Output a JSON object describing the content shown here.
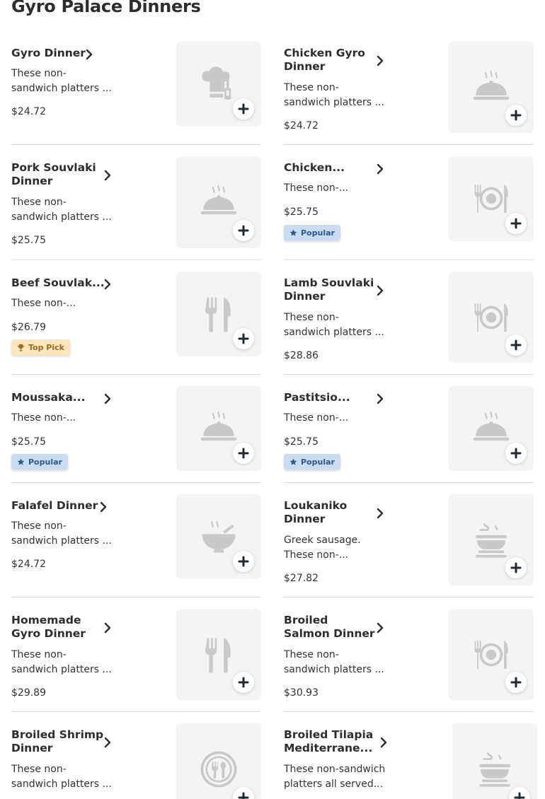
{
  "section": {
    "title": "Gyro Palace Dinners"
  },
  "badges": {
    "popular": "Popular",
    "top_pick": "Top Pick"
  },
  "colors": {
    "popular_bg": "#c9dcf2",
    "top_pick_bg": "#fde6bd",
    "thumb_bg": "#f4f4f4",
    "icon": "#c9c9c9"
  },
  "items": [
    {
      "name": "Gyro Dinner",
      "desc": "These non-\nsandwich platters ...",
      "price": "$24.72",
      "badge": "",
      "icon": "chef-icon"
    },
    {
      "name": "Chicken Gyro\nDinner",
      "desc": "These non-\nsandwich platters ...",
      "price": "$24.72",
      "badge": "",
      "icon": "cloche-icon"
    },
    {
      "name": "Pork Souvlaki\nDinner",
      "desc": "These non-\nsandwich platters ...",
      "price": "$25.75",
      "badge": "",
      "icon": "cloche-icon"
    },
    {
      "name": "Chicken...",
      "desc": "These non-...",
      "price": "$25.75",
      "badge": "Popular",
      "icon": "plate-cutlery-icon"
    },
    {
      "name": "Beef Souvlak...",
      "desc": "These non-...",
      "price": "$26.79",
      "badge": "Top Pick",
      "icon": "fork-knife-icon"
    },
    {
      "name": "Lamb Souvlaki\nDinner",
      "desc": "These non-\nsandwich platters ...",
      "price": "$28.86",
      "badge": "",
      "icon": "plate-cutlery-icon"
    },
    {
      "name": "Moussaka...",
      "desc": "These non-...",
      "price": "$25.75",
      "badge": "Popular",
      "icon": "cloche-icon"
    },
    {
      "name": "Pastitsio...",
      "desc": "These non-...",
      "price": "$25.75",
      "badge": "Popular",
      "icon": "cloche-icon"
    },
    {
      "name": "Falafel Dinner",
      "desc": "These non-\nsandwich platters ...",
      "price": "$24.72",
      "badge": "",
      "icon": "bowl-spoon-icon"
    },
    {
      "name": "Loukaniko\nDinner",
      "desc": "Greek sausage.\nThese non-...",
      "price": "$27.82",
      "badge": "",
      "icon": "soup-icon"
    },
    {
      "name": "Homemade\nGyro Dinner",
      "desc": "These non-\nsandwich platters ...",
      "price": "$29.89",
      "badge": "",
      "icon": "fork-knife-icon"
    },
    {
      "name": "Broiled\nSalmon Dinner",
      "desc": "These non-\nsandwich platters ...",
      "price": "$30.93",
      "badge": "",
      "icon": "plate-cutlery-icon"
    },
    {
      "name": "Broiled Shrimp\nDinner",
      "desc": "These non-\nsandwich platters ...",
      "price": "",
      "badge": "",
      "icon": "plate-circle-icon"
    },
    {
      "name": "Broiled Tilapia\nMediterrane...",
      "desc": "These non-sandwich\nplatters all served...",
      "price": "",
      "badge": "",
      "icon": "soup-icon"
    }
  ]
}
